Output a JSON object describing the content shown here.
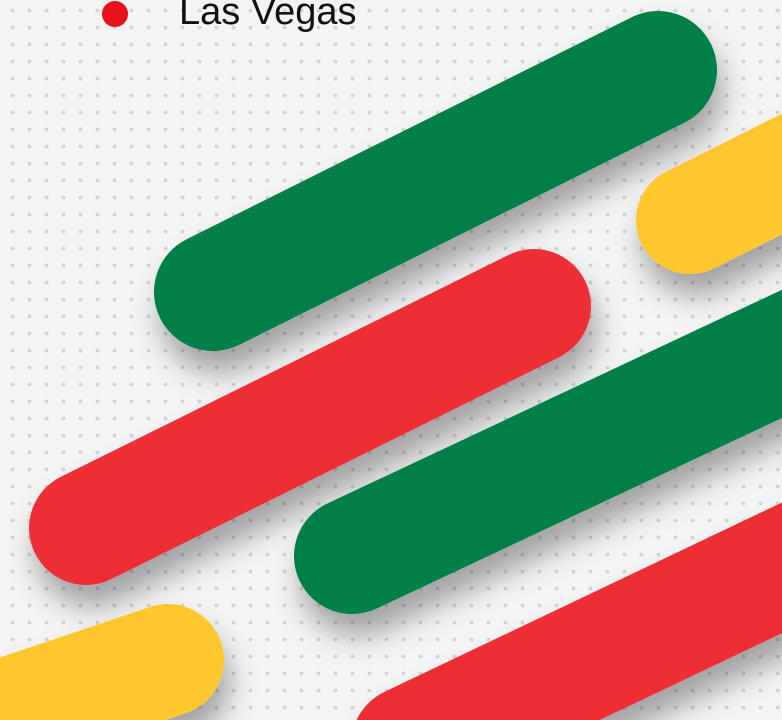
{
  "list": {
    "item_label": "Las Vegas",
    "bullet_color": "#e8121e"
  },
  "colors": {
    "background": "#f4f4f4",
    "dot_pattern": "#d2d2d2",
    "green": "#057f46",
    "red": "#ee2e36",
    "yellow": "#fec72e"
  }
}
